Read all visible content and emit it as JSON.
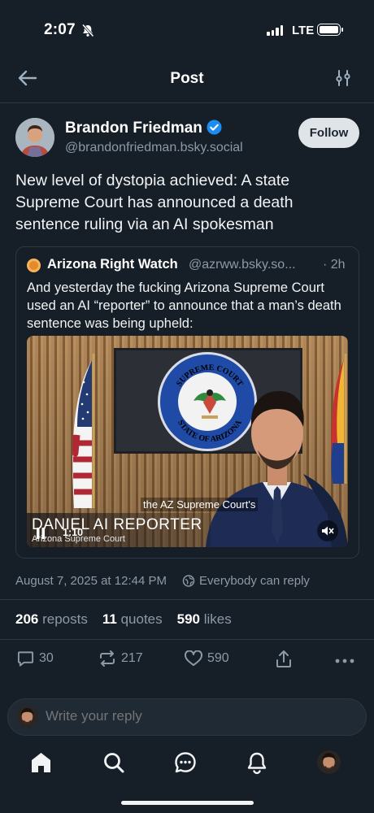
{
  "status_bar": {
    "time": "2:07",
    "network": "LTE"
  },
  "header": {
    "title": "Post"
  },
  "post": {
    "author_name": "Brandon Friedman",
    "author_handle": "@brandonfriedman.bsky.social",
    "follow_label": "Follow",
    "text": "New level of dystopia achieved: A state Supreme Court has announced a death sentence ruling via an AI spokesman",
    "date": "August 7, 2025 at 12:44 PM",
    "reply_permission": "Everybody can reply",
    "stats": {
      "reposts_count": "206",
      "reposts_label": "reposts",
      "quotes_count": "11",
      "quotes_label": "quotes",
      "likes_count": "590",
      "likes_label": "likes"
    },
    "actions": {
      "reply_count": "30",
      "repost_count": "217",
      "like_count": "590"
    }
  },
  "quote": {
    "author_name": "Arizona Right Watch",
    "author_handle": "@azrww.bsky.so...",
    "time": "· 2h",
    "text": "And yesterday the fucking Arizona Supreme Court used an AI “reporter” to announce that a man’s death sentence was being upheld:",
    "video": {
      "seal_top": "SUPREME COURT",
      "seal_bottom": "STATE OF ARIZONA",
      "caption": "the AZ Supreme Court's",
      "lower_third_title": "DANIEL  AI REPORTER",
      "lower_third_subtitle": "Arizona Supreme Court",
      "duration": "1:10"
    }
  },
  "composer": {
    "placeholder": "Write your reply"
  },
  "tab_bar": {
    "items": [
      "home-icon",
      "search-icon",
      "chat-icon",
      "bell-icon",
      "profile-avatar"
    ]
  },
  "colors": {
    "background": "#161e27",
    "muted_text": "#8c9aa8",
    "verified_blue": "#1d8cf0",
    "follow_bg": "#dfe4e9"
  }
}
